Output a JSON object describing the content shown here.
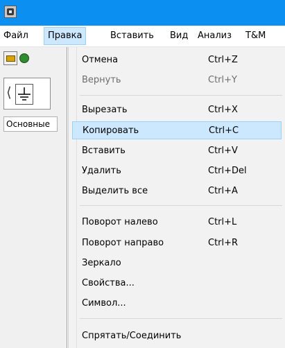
{
  "menubar": {
    "items": [
      "Файл",
      "Правка",
      "Вставить",
      "Вид",
      "Анализ",
      "T&M"
    ],
    "active": "Правка"
  },
  "toolbar": {
    "icons": [
      "open-folder-icon",
      "globe-icon",
      "ground-symbol-icon"
    ],
    "tab_label": "Основные"
  },
  "dropdown": {
    "items": [
      {
        "label": "Отмена",
        "shortcut": "Ctrl+Z"
      },
      {
        "label": "Вернуть",
        "shortcut": "Ctrl+Y",
        "disabled": true
      },
      {
        "label": "Вырезать",
        "shortcut": "Ctrl+X"
      },
      {
        "label": "Копировать",
        "shortcut": "Ctrl+C",
        "highlighted": true
      },
      {
        "label": "Вставить",
        "shortcut": "Ctrl+V"
      },
      {
        "label": "Удалить",
        "shortcut": "Ctrl+Del"
      },
      {
        "label": "Выделить все",
        "shortcut": "Ctrl+A"
      },
      {
        "label": "Поворот налево",
        "shortcut": "Ctrl+L"
      },
      {
        "label": "Поворот направо",
        "shortcut": "Ctrl+R"
      },
      {
        "label": "Зеркало",
        "shortcut": ""
      },
      {
        "label": "Свойства...",
        "shortcut": ""
      },
      {
        "label": "Символ...",
        "shortcut": ""
      },
      {
        "label": "Спрятать/Соединить",
        "shortcut": ""
      }
    ]
  },
  "colors": {
    "titlebar": "#0b8ff0",
    "highlight": "#cce8ff",
    "highlight_border": "#99d1ff",
    "menu_bg": "#f2f2f2"
  }
}
